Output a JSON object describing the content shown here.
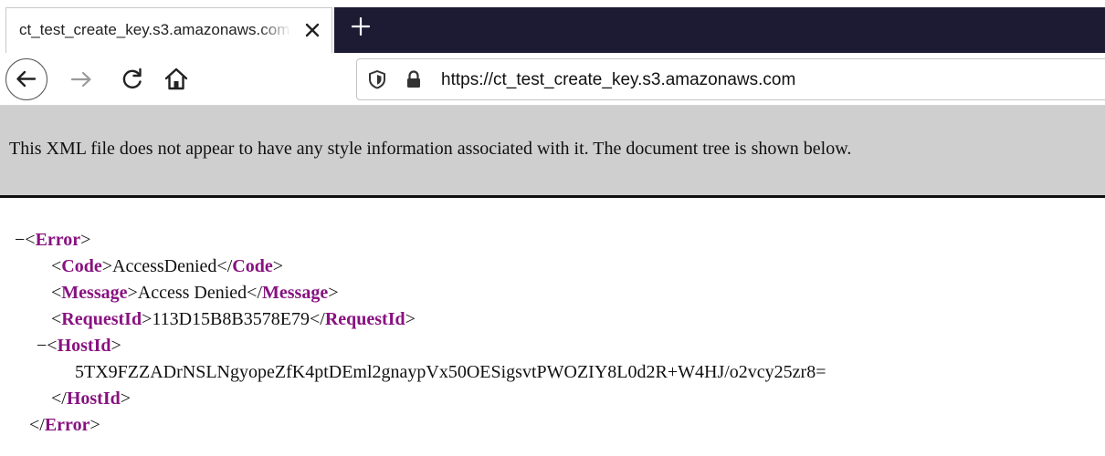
{
  "browser": {
    "tab": {
      "title": "ct_test_create_key.s3.amazonaws.com"
    },
    "address_bar": {
      "url": "https://ct_test_create_key.s3.amazonaws.com"
    }
  },
  "xml_viewer": {
    "info_message": "This XML file does not appear to have any style information associated with it. The document tree is shown below.",
    "collapse_glyph": "−",
    "tree": {
      "error": {
        "name": "Error"
      },
      "code": {
        "name": "Code",
        "value": "AccessDenied"
      },
      "message": {
        "name": "Message",
        "value": "Access Denied"
      },
      "request_id": {
        "name": "RequestId",
        "value": "113D15B8B3578E79"
      },
      "host_id": {
        "name": "HostId",
        "value": "5TX9FZZADrNSLNgyopeZfK4ptDEml2gnaypVx50OESigsvtPWOZIY8L0d2R+W4HJ/o2vcy25zr8="
      }
    }
  },
  "colors": {
    "tab_strip": "#1c1b33",
    "banner": "#cfcfcf",
    "tag": "#881280"
  },
  "icons": [
    "close-icon",
    "plus-icon",
    "back-arrow-icon",
    "forward-arrow-icon",
    "reload-icon",
    "home-icon",
    "shield-icon",
    "lock-icon"
  ]
}
